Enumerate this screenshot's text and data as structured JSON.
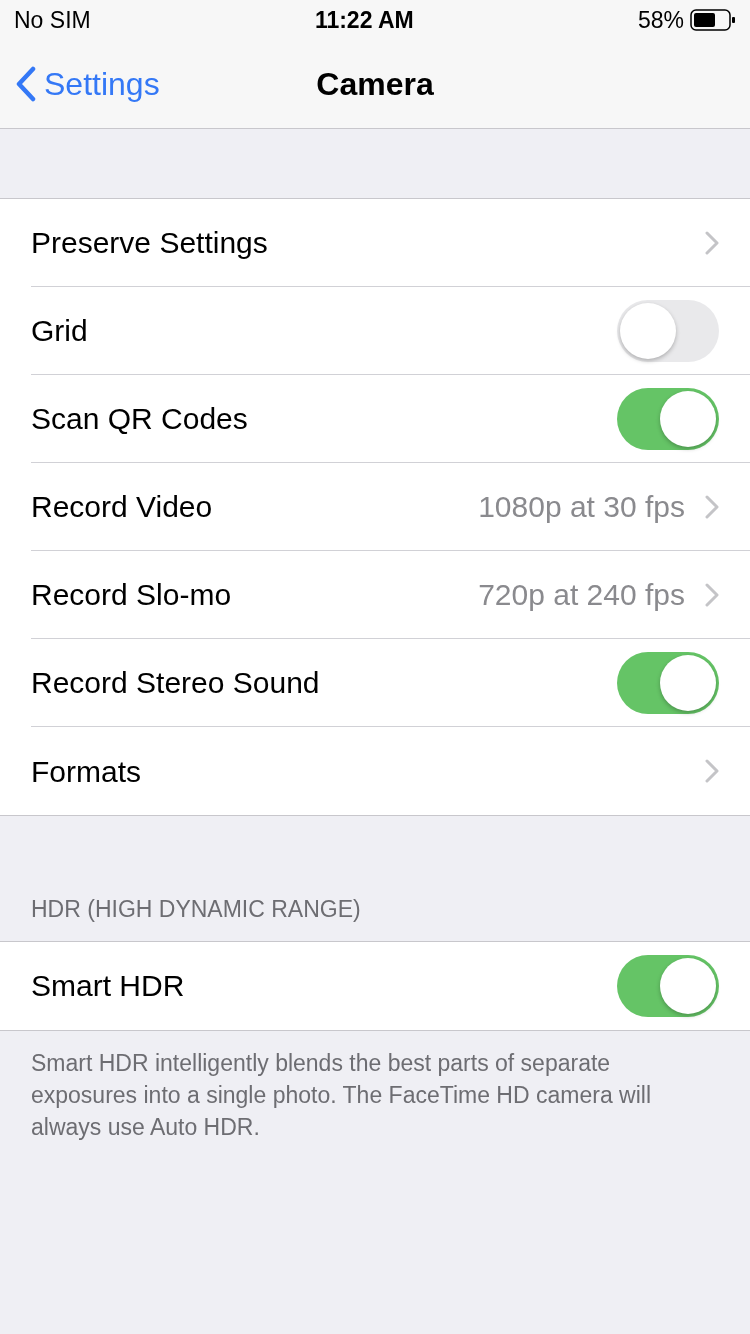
{
  "status_bar": {
    "carrier": "No SIM",
    "time": "11:22 AM",
    "battery": "58%"
  },
  "nav": {
    "back": "Settings",
    "title": "Camera"
  },
  "sections": [
    {
      "rows": [
        {
          "kind": "link",
          "label": "Preserve Settings"
        },
        {
          "kind": "toggle",
          "label": "Grid",
          "on": false
        },
        {
          "kind": "toggle",
          "label": "Scan QR Codes",
          "on": true
        },
        {
          "kind": "link",
          "label": "Record Video",
          "value": "1080p at 30 fps"
        },
        {
          "kind": "link",
          "label": "Record Slo-mo",
          "value": "720p at 240 fps"
        },
        {
          "kind": "toggle",
          "label": "Record Stereo Sound",
          "on": true
        },
        {
          "kind": "link",
          "label": "Formats"
        }
      ]
    },
    {
      "header": "HDR (HIGH DYNAMIC RANGE)",
      "rows": [
        {
          "kind": "toggle",
          "label": "Smart HDR",
          "on": true
        }
      ],
      "footer": "Smart HDR intelligently blends the best parts of separate exposures into a single photo. The FaceTime HD camera will always use Auto HDR."
    }
  ]
}
